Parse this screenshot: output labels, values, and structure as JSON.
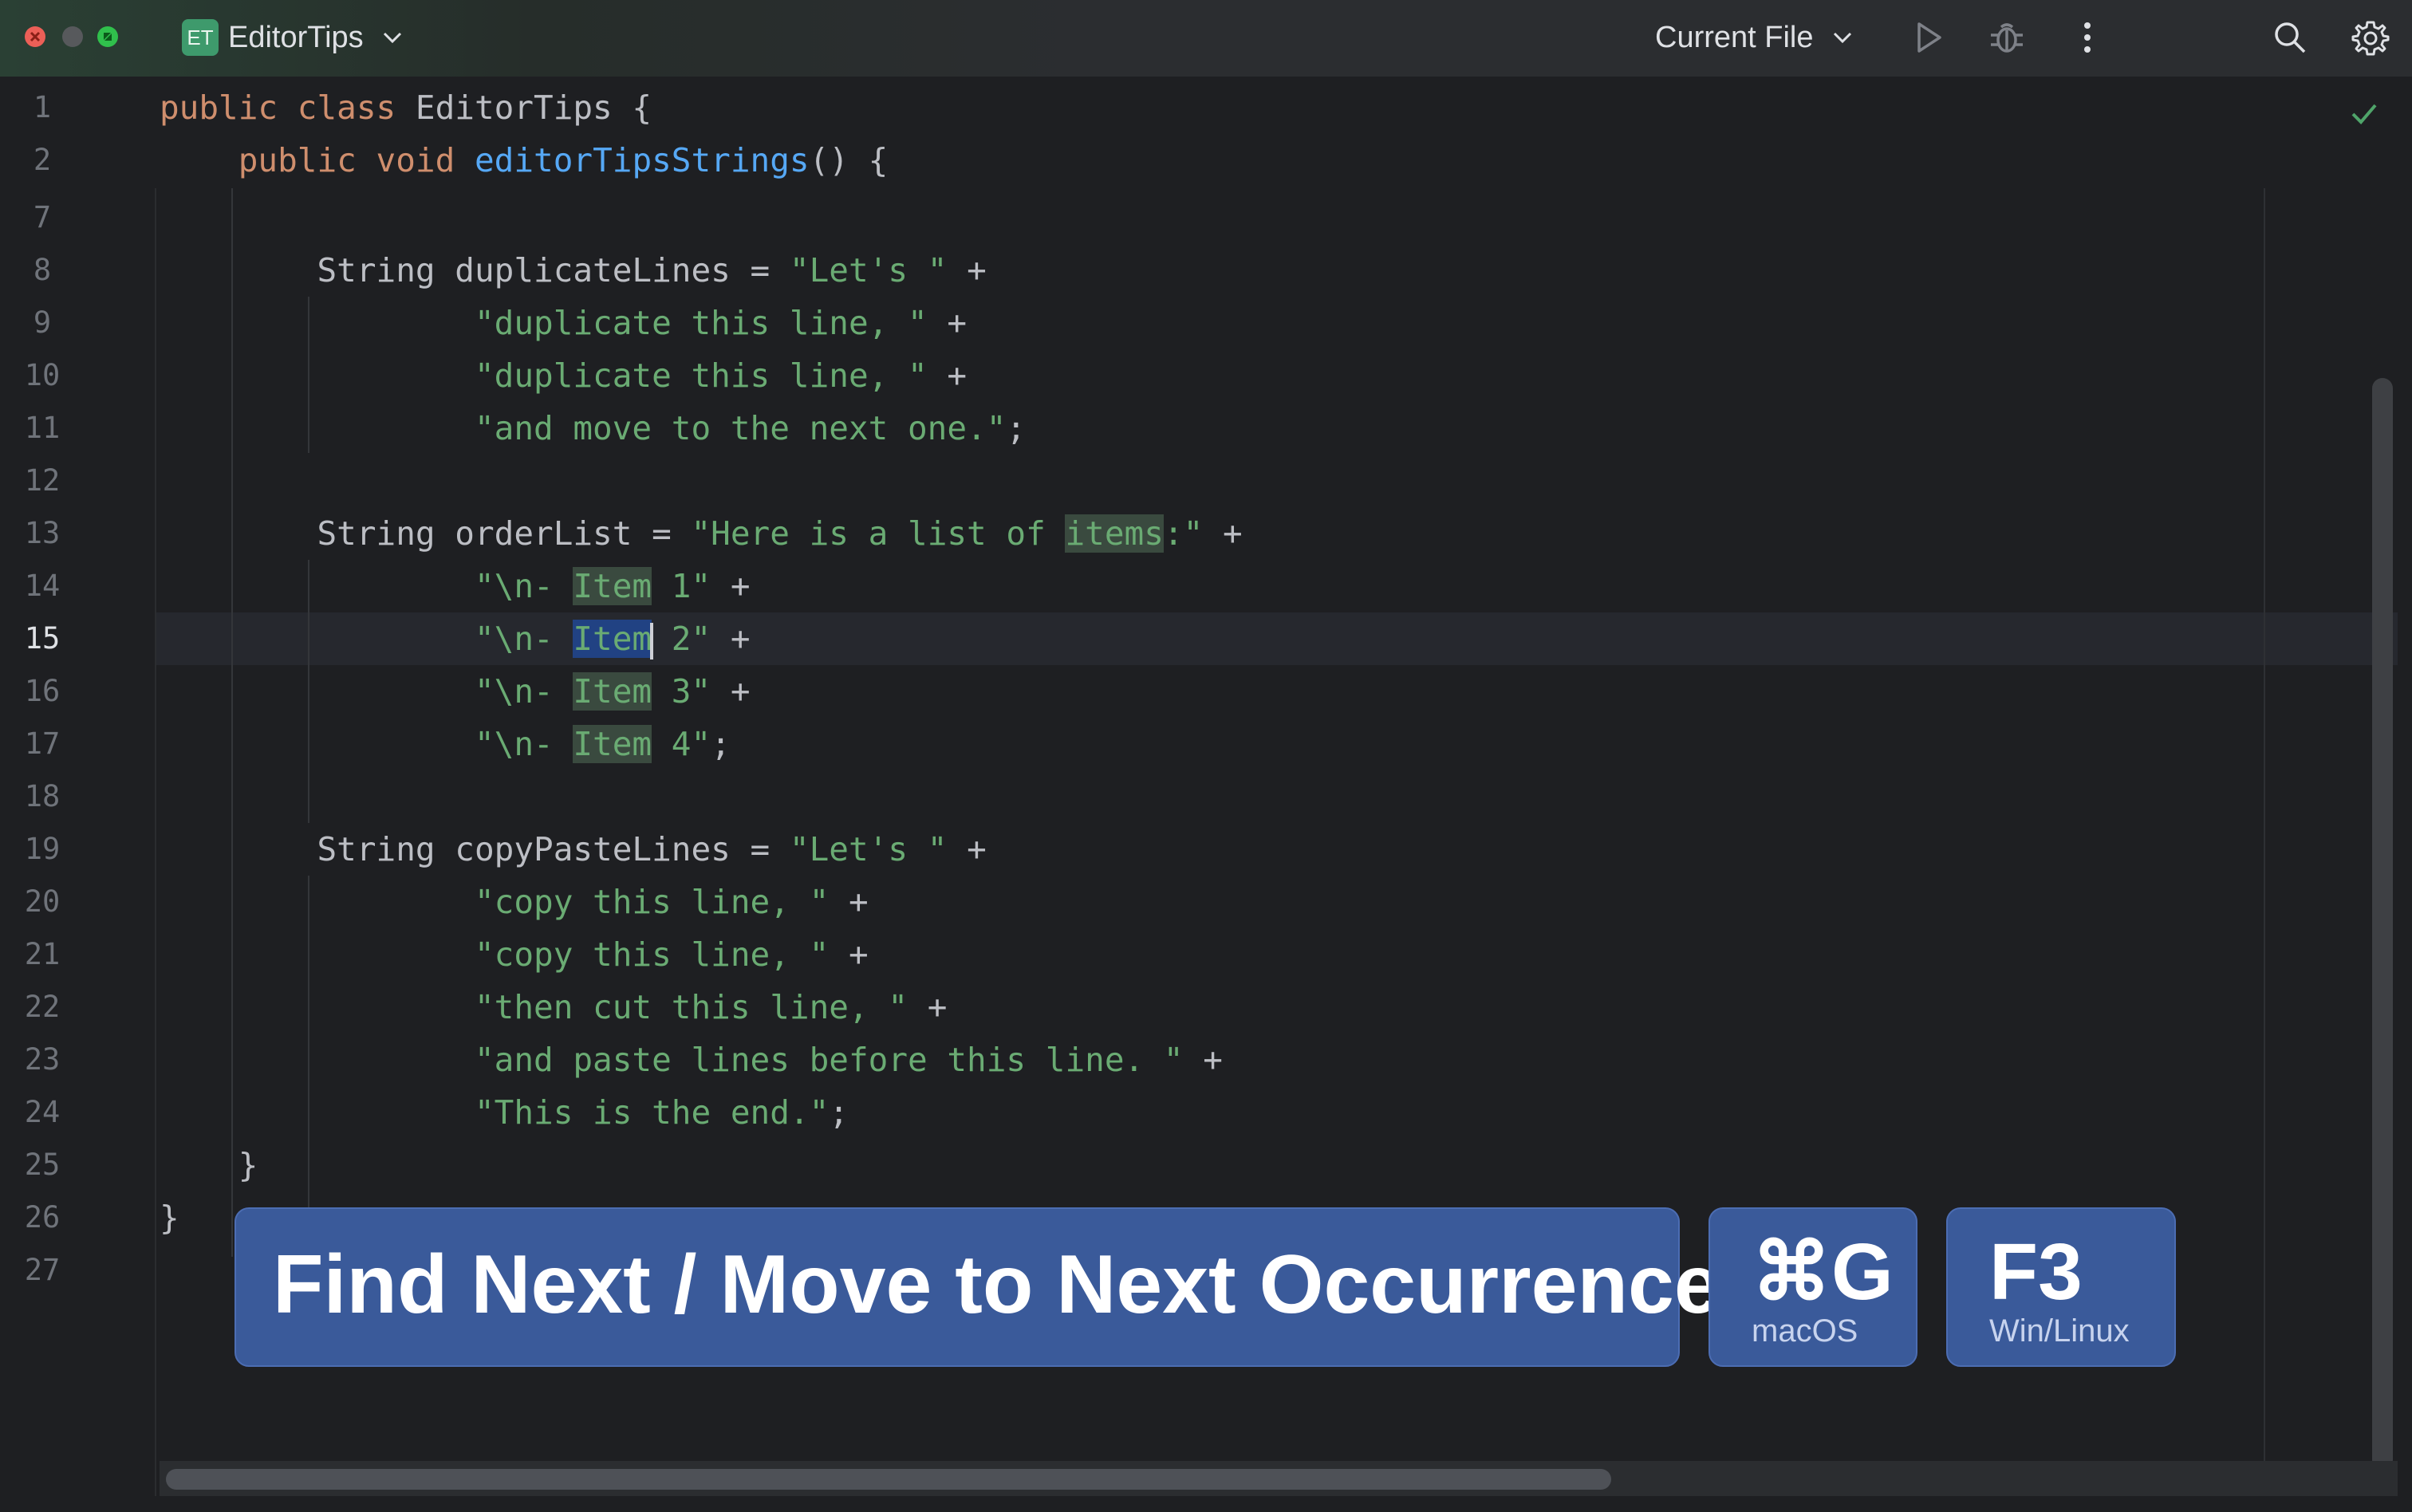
{
  "window": {
    "project_badge": "ET",
    "project_name": "EditorTips",
    "run_config": "Current File"
  },
  "icons": {
    "project_chevron": "chevron-down-icon",
    "run": "play-icon",
    "debug": "bug-icon",
    "more": "more-vertical-icon",
    "search": "search-icon",
    "settings": "gear-icon",
    "inspection": "check-icon"
  },
  "colors": {
    "keyword": "#cf8e6d",
    "function": "#56a8f5",
    "string": "#6aab73",
    "selection": "#214283",
    "occurrence_highlight": "#3a4a3f",
    "banner": "#3a5a9a"
  },
  "editor": {
    "current_line": "15",
    "line_numbers": [
      "1",
      "2",
      "7",
      "8",
      "9",
      "10",
      "11",
      "12",
      "13",
      "14",
      "15",
      "16",
      "17",
      "18",
      "19",
      "20",
      "21",
      "22",
      "23",
      "24",
      "25",
      "26",
      "27"
    ],
    "code": {
      "l1_kw": "public class",
      "l1_rest": " EditorTips {",
      "l2_kw": "public void",
      "l2_fn": "editorTipsStrings",
      "l2_rest": "() {",
      "l8_decl": "String duplicateLines = ",
      "l8_str": "\"Let's \"",
      "l9_str": "\"duplicate this line, \"",
      "l10_str": "\"duplicate this line, \"",
      "l11_str": "\"and move to the next one.\"",
      "l13_decl": "String orderList = ",
      "l13_str_a": "\"Here is a list of ",
      "l13_hl": "items",
      "l13_str_b": ":\"",
      "l14_pre": "\"\\n- ",
      "l14_hl": "Item",
      "l14_post": " 1\"",
      "l15_pre": "\"\\n- ",
      "l15_hl": "Item",
      "l15_post": " 2\"",
      "l16_pre": "\"\\n- ",
      "l16_hl": "Item",
      "l16_post": " 3\"",
      "l17_pre": "\"\\n- ",
      "l17_hl": "Item",
      "l17_post": " 4\"",
      "l19_decl": "String copyPasteLines = ",
      "l19_str": "\"Let's \"",
      "l20_str": "\"copy this line, \"",
      "l21_str": "\"copy this line, \"",
      "l22_str": "\"then cut this line, \"",
      "l23_str": "\"and paste lines before this line. \"",
      "l24_str": "\"This is the end.\"",
      "plus": " +",
      "semicolon": ";",
      "close_brace": "}"
    }
  },
  "overlay": {
    "action": "Find Next / Move to Next Occurrence",
    "mac_key": "⌘G",
    "mac_os": "macOS",
    "win_key": "F3",
    "win_os": "Win/Linux"
  }
}
